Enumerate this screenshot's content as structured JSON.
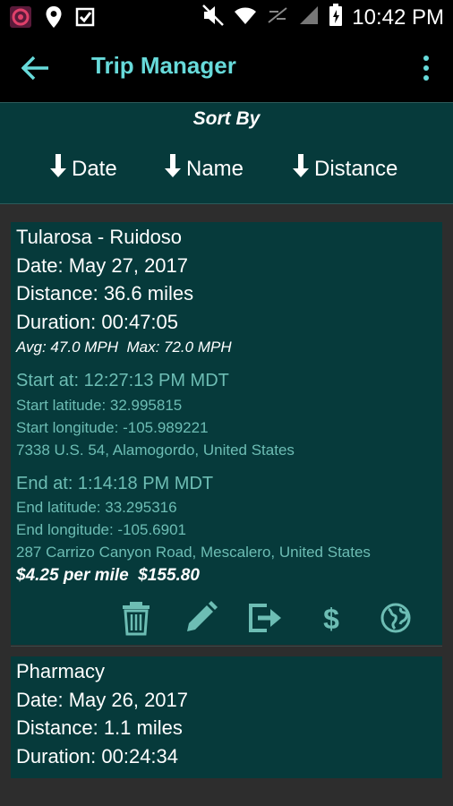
{
  "status": {
    "time": "10:42 PM"
  },
  "appbar": {
    "title": "Trip Manager"
  },
  "sort": {
    "heading": "Sort By",
    "buttons": [
      {
        "label": "Date",
        "icon": "arrow-down-icon"
      },
      {
        "label": "Name",
        "icon": "arrow-down-icon"
      },
      {
        "label": "Distance",
        "icon": "arrow-down-icon"
      }
    ]
  },
  "trips": [
    {
      "name": "Tularosa - Ruidoso",
      "date": "Date: May 27, 2017",
      "distance": "Distance: 36.6 miles",
      "duration": "Duration: 00:47:05",
      "speeds": "Avg: 47.0 MPH  Max: 72.0 MPH",
      "start_at": "Start at: 12:27:13 PM MDT",
      "start_lat": "Start latitude: 32.995815",
      "start_lon": "Start longitude: -105.989221",
      "start_addr": "7338 U.S. 54, Alamogordo, United States",
      "end_at": "End at: 1:14:18 PM MDT",
      "end_lat": "End latitude: 33.295316",
      "end_lon": "End longitude: -105.6901",
      "end_addr": "287 Carrizo Canyon Road, Mescalero, United States",
      "price": "$4.25 per mile  $155.80"
    },
    {
      "name": "Pharmacy",
      "date": "Date: May 26, 2017",
      "distance": "Distance: 1.1 miles",
      "duration": "Duration: 00:24:34"
    }
  ],
  "colors": {
    "accent": "#67dada",
    "card": "#063a3b",
    "teal_text": "#6dbdb4"
  },
  "icons": [
    "delete-icon",
    "edit-icon",
    "export-icon",
    "dollar-icon",
    "globe-icon"
  ]
}
